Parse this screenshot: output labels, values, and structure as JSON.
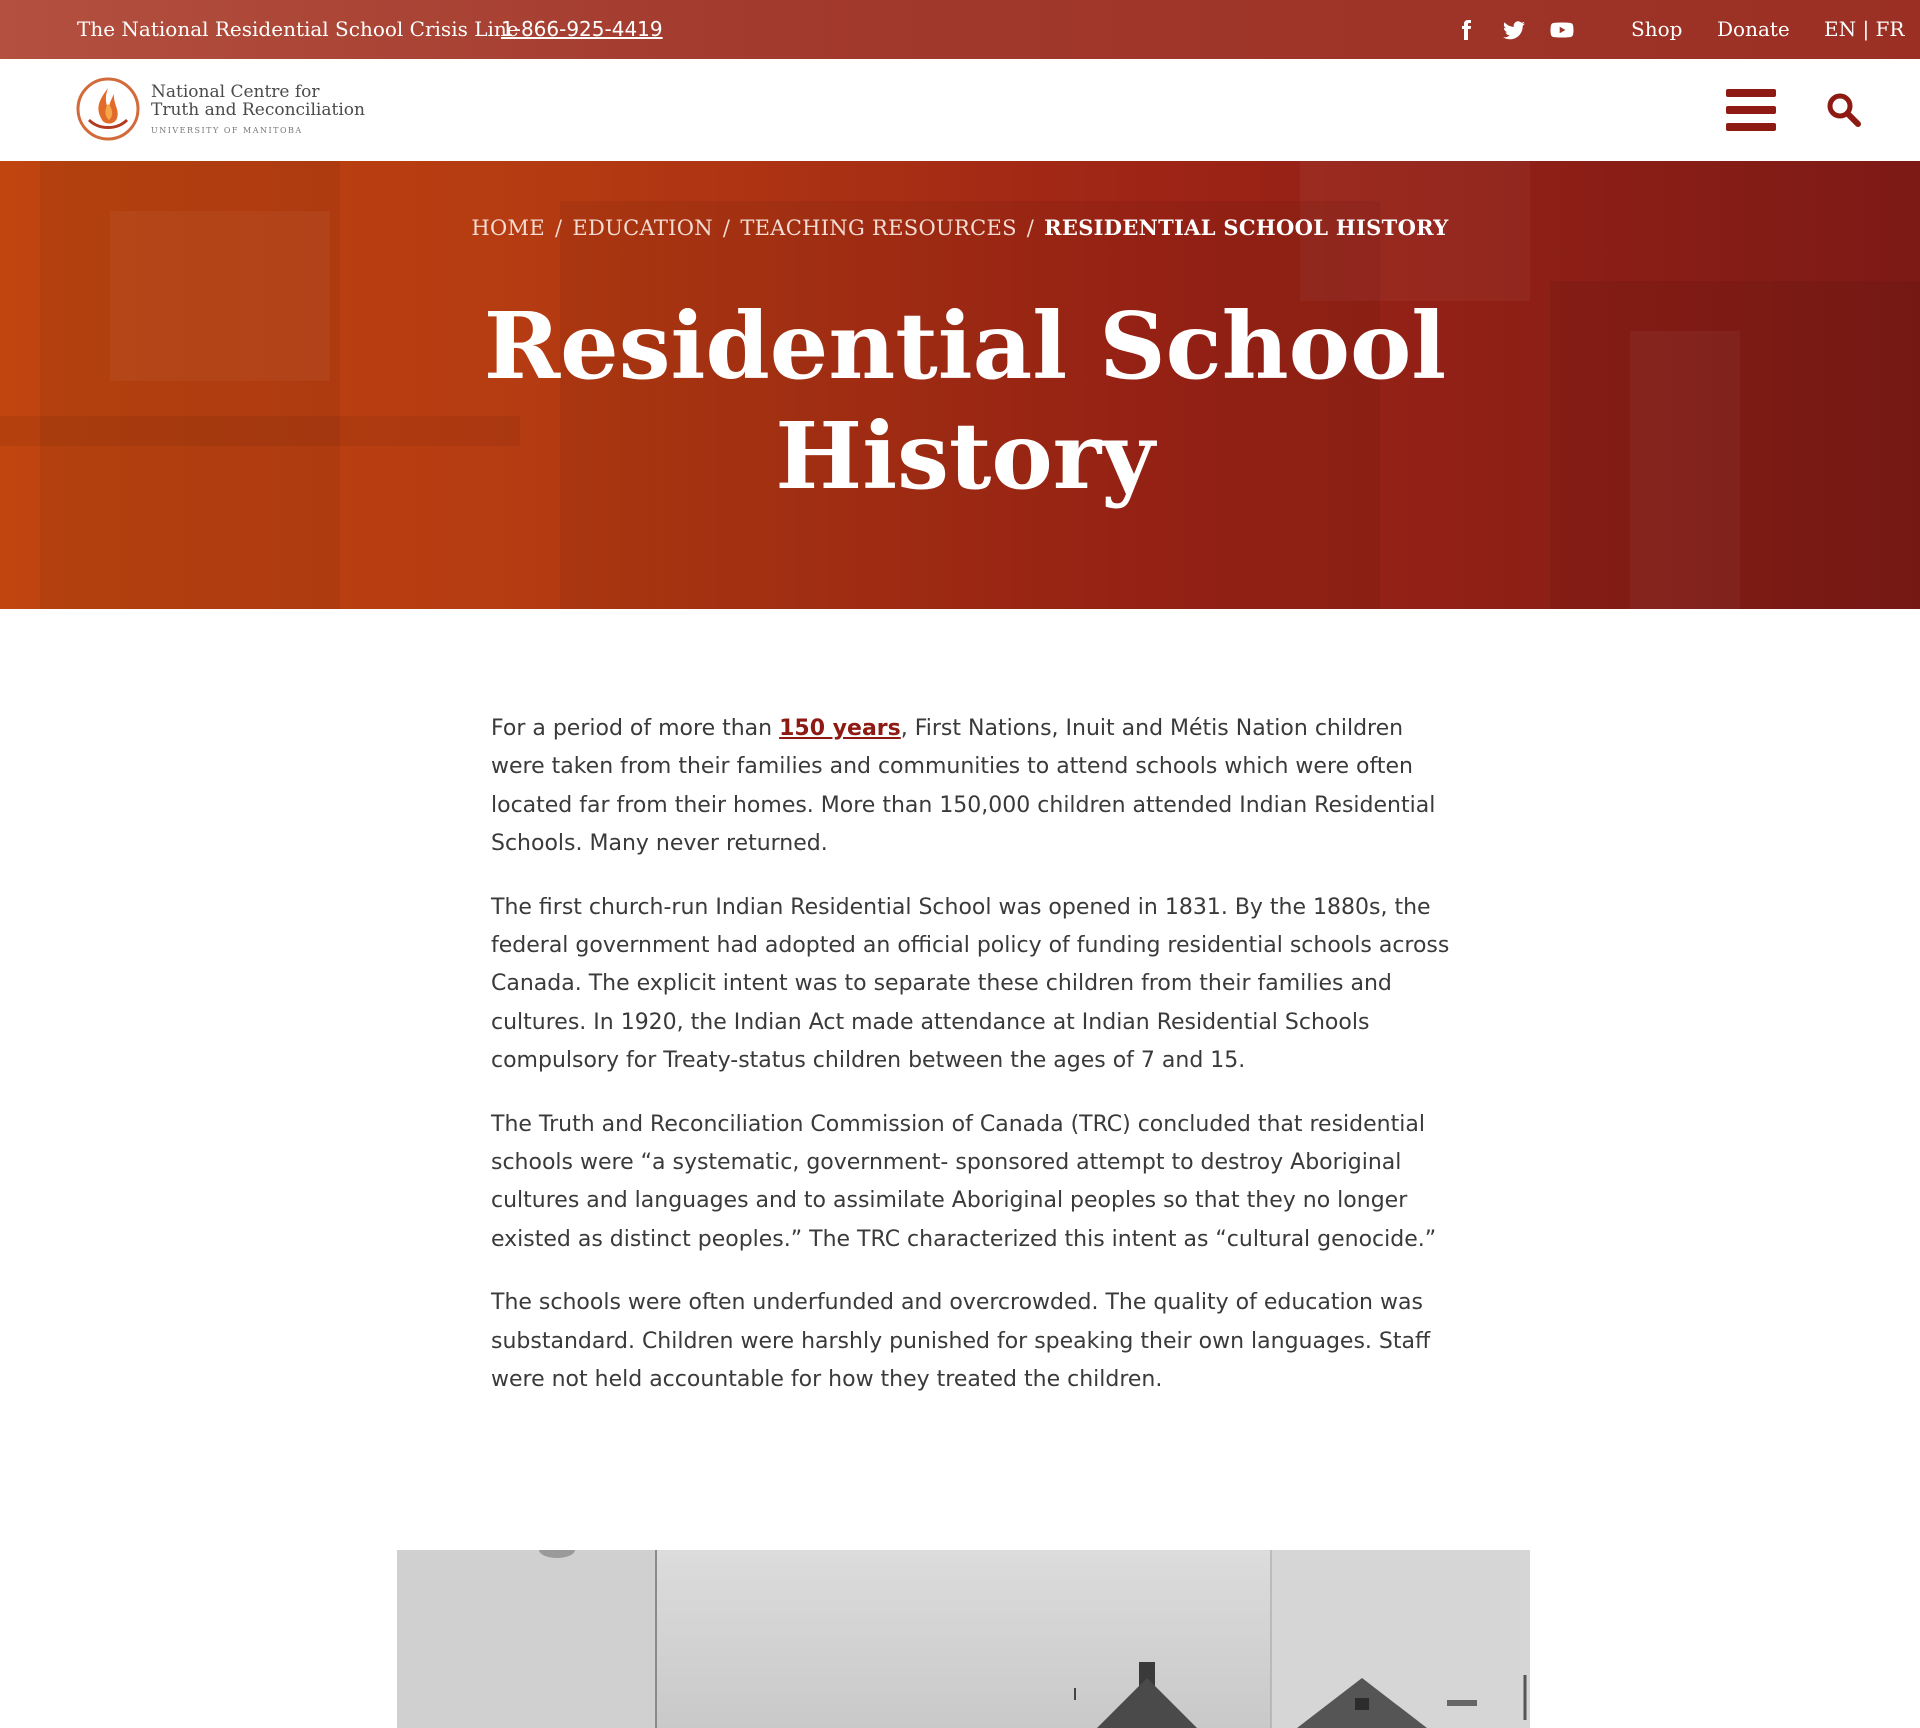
{
  "topbar": {
    "crisis_label": "The National Residential School Crisis Line",
    "crisis_phone": "1-866-925-4419",
    "social": [
      "facebook-icon",
      "twitter-icon",
      "youtube-icon"
    ],
    "shop": "Shop",
    "donate": "Donate",
    "lang": "EN | FR"
  },
  "header": {
    "logo_line1": "National Centre for",
    "logo_line2": "Truth and Reconciliation",
    "logo_line3": "UNIVERSITY OF MANITOBA",
    "menu_icon": "hamburger-menu-icon",
    "search_icon": "search-icon"
  },
  "hero": {
    "breadcrumb": [
      "HOME",
      "EDUCATION",
      "TEACHING RESOURCES"
    ],
    "breadcrumb_current": "RESIDENTIAL SCHOOL HISTORY",
    "title_line1": "Residential School",
    "title_line2": "History"
  },
  "content": {
    "p1_before": "For a period of more than ",
    "p1_link": "150 years",
    "p1_after": ", First Nations, Inuit and Métis Nation children were taken from their families and communities to attend schools which were often located far from their homes. More than 150,000 children attended Indian Residential Schools. Many never returned.",
    "p2": "The first church-run Indian Residential School was opened in 1831. By the 1880s, the federal government had adopted an official policy of funding residential schools across Canada. The explicit intent was to separate these children from their families and cultures. In 1920, the Indian Act made attendance at Indian Residential Schools compulsory for Treaty-status children between the ages of 7 and 15.",
    "p3": "The Truth and Reconciliation Commission of Canada (TRC) concluded that residential schools were “a systematic, government- sponsored attempt to destroy Aboriginal cultures and languages and to assimilate Aboriginal peoples so that they no longer existed as distinct peoples.” The TRC characterized this intent as “cultural genocide.”",
    "p4": "The schools were often underfunded and overcrowded. The quality of education was substandard. Children were harshly punished for speaking their own languages. Staff were not held accountable for how they treated the children."
  },
  "colors": {
    "accent": "#8e1b13",
    "topbar": "#a23a2d",
    "hero_start": "#c0450f",
    "hero_end": "#7d1a16"
  }
}
